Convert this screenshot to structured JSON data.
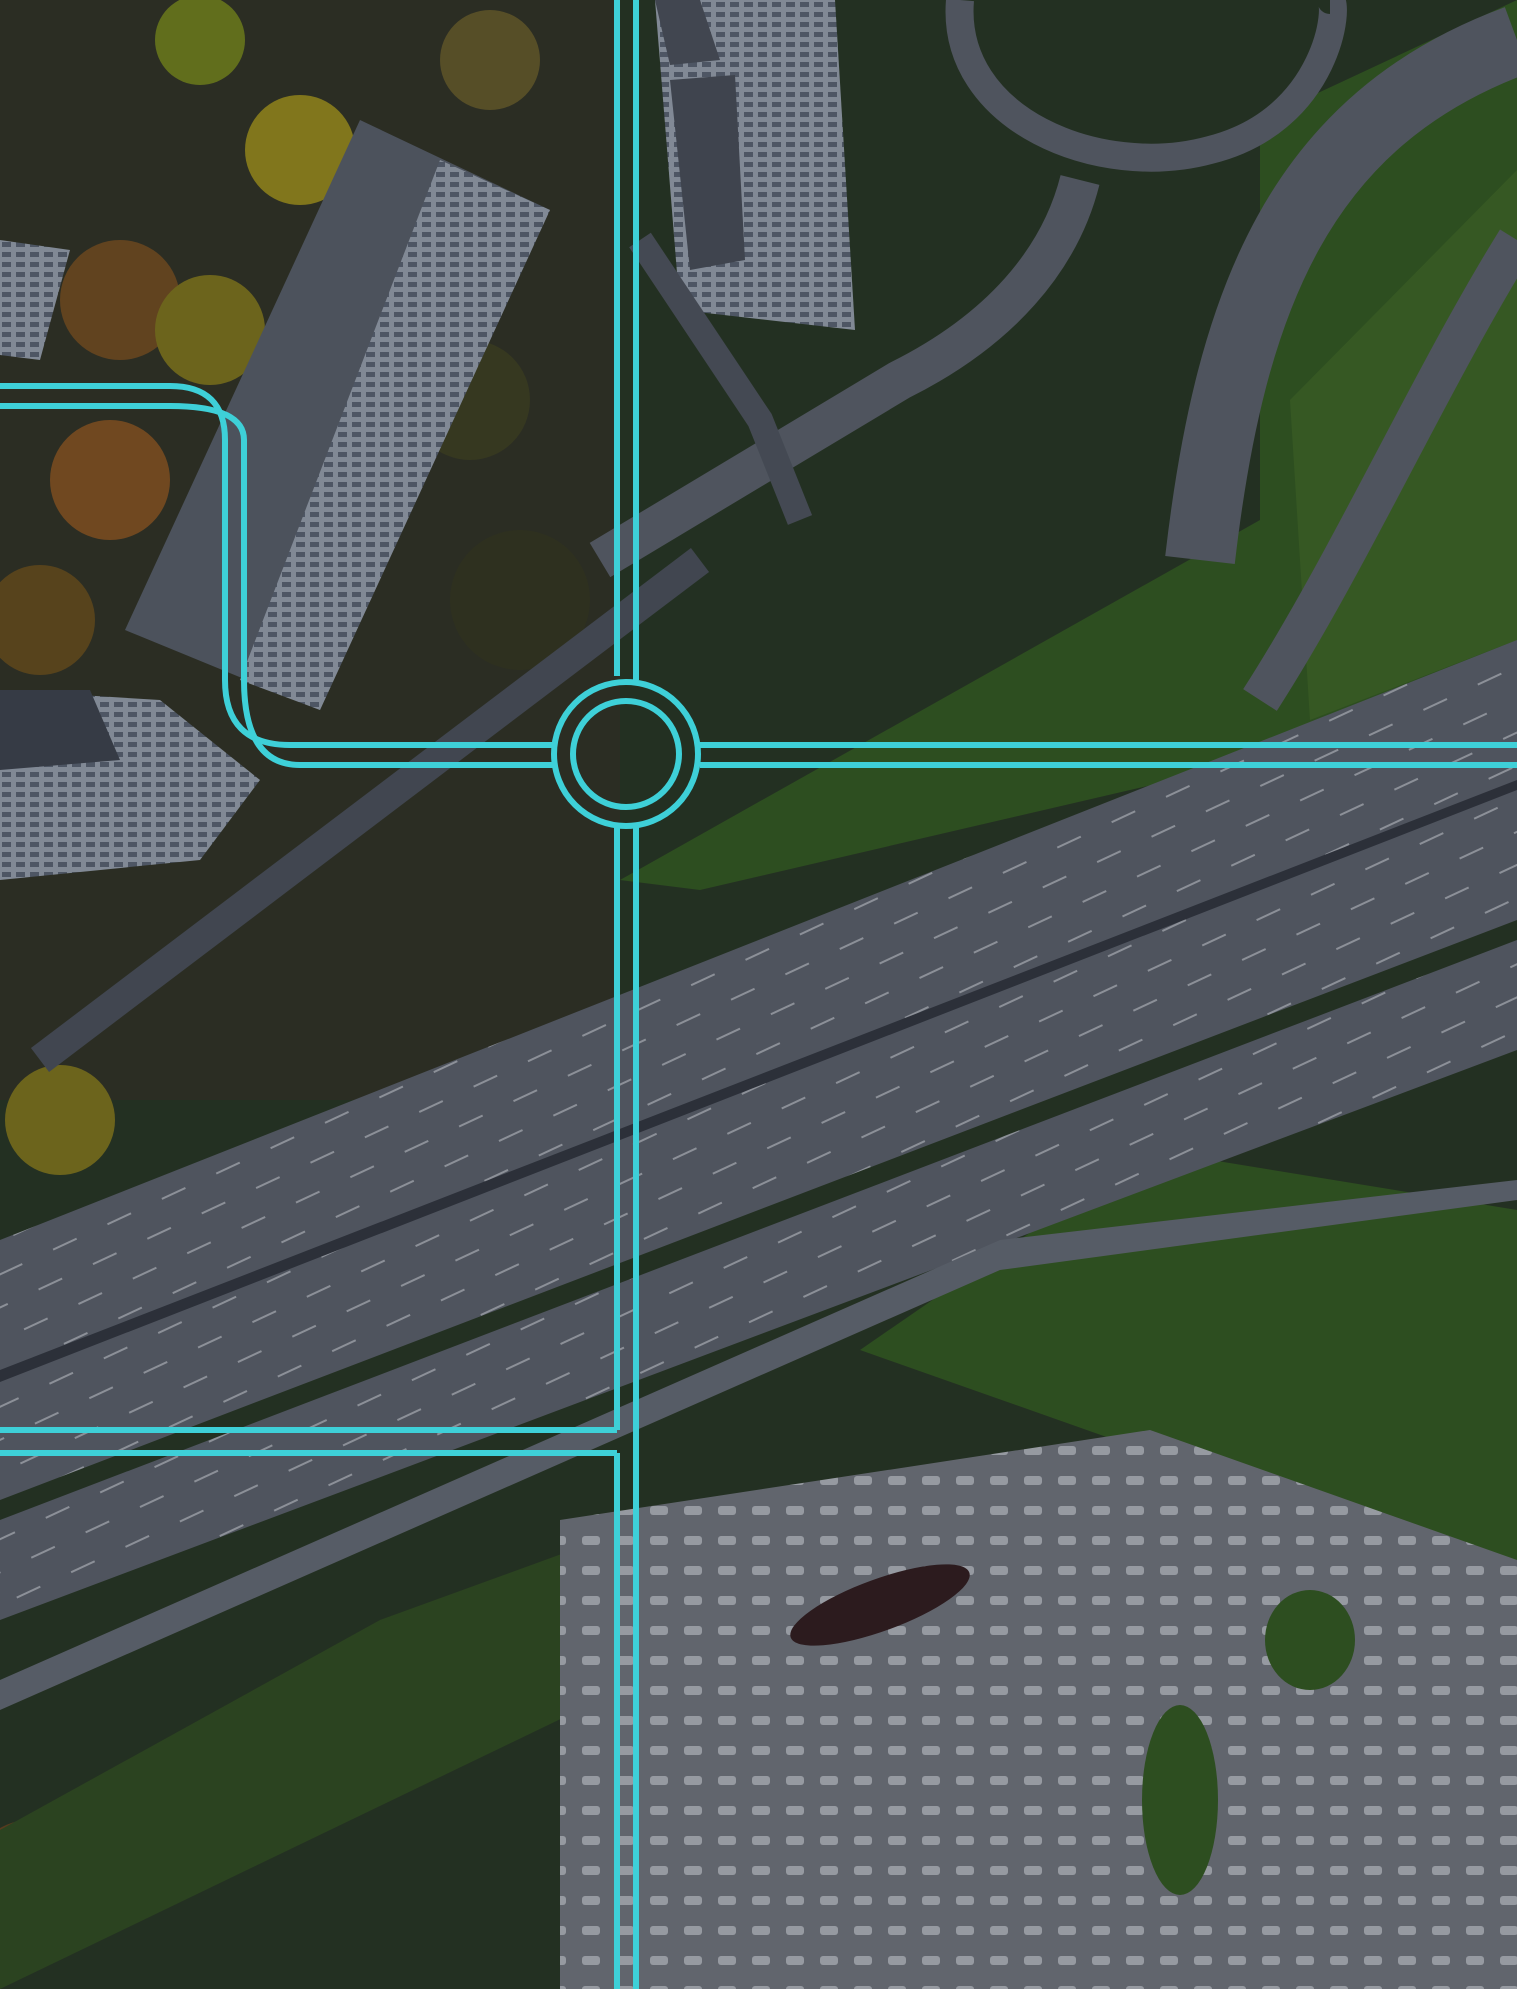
{
  "image": {
    "subject": "aerial-highway-interchange",
    "overlay_line_color": "#3ed0d8",
    "tint": "#0b1322"
  },
  "palette": {
    "grass": "#365a1d",
    "grass_light": "#4b7424",
    "road": "#7a7f86",
    "road_dark": "#4d5158",
    "building": "#a9b2bf",
    "roof": "#575c63",
    "tree_autumn": "#8a5a1e",
    "tree_yellow": "#9a8b1a",
    "plaza": "#8c8f93"
  }
}
